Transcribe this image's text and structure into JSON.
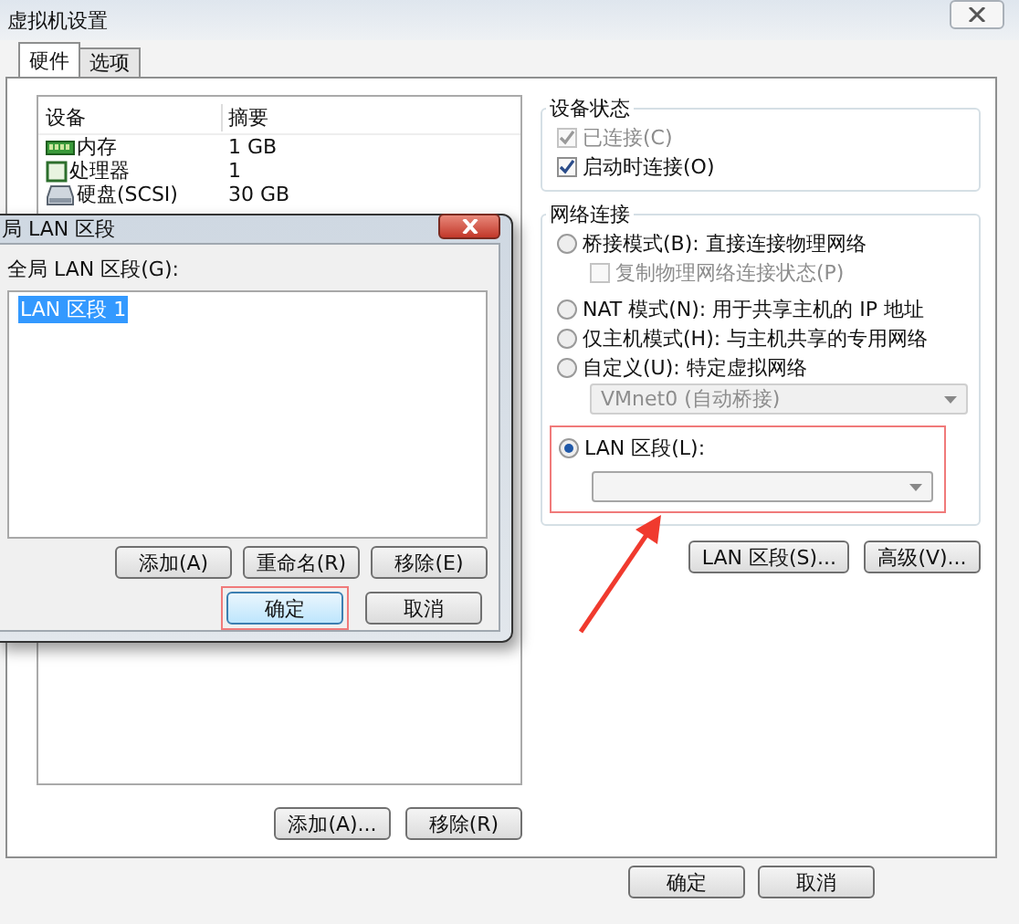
{
  "window": {
    "title": "虚拟机设置"
  },
  "tabs": [
    {
      "label": "硬件",
      "selected": true
    },
    {
      "label": "选项",
      "selected": false
    }
  ],
  "device_table": {
    "columns": [
      "设备",
      "摘要"
    ],
    "rows": [
      {
        "kind": "memory",
        "device": "内存",
        "summary": "1 GB"
      },
      {
        "kind": "cpu",
        "device": "处理器",
        "summary": "1"
      },
      {
        "kind": "disk",
        "device": "硬盘(SCSI)",
        "summary": "30 GB"
      }
    ]
  },
  "device_buttons": [
    "添加(A)...",
    "移除(R)"
  ],
  "device_status": {
    "title": "设备状态",
    "options": [
      {
        "label": "已连接(C)",
        "checked": true,
        "disabled": true
      },
      {
        "label": "启动时连接(O)",
        "checked": true,
        "disabled": false
      }
    ]
  },
  "network": {
    "title": "网络连接",
    "options": [
      {
        "kind": "radio",
        "label": "桥接模式(B): 直接连接物理网络",
        "selected": false
      },
      {
        "kind": "checkbox",
        "label": "复制物理网络连接状态(P)",
        "checked": false,
        "disabled": true
      },
      {
        "kind": "radio",
        "label": "NAT 模式(N): 用于共享主机的 IP 地址",
        "selected": false
      },
      {
        "kind": "radio",
        "label": "仅主机模式(H): 与主机共享的专用网络",
        "selected": false
      },
      {
        "kind": "radio",
        "label": "自定义(U): 特定虚拟网络",
        "selected": false
      },
      {
        "kind": "dropdown",
        "value": "VMnet0 (自动桥接)",
        "disabled": true
      }
    ],
    "lan_segment": {
      "label": "LAN 区段(L):",
      "selected": true,
      "highlighted": true,
      "dropdown_disabled": false
    }
  },
  "network_buttons": [
    "LAN 区段(S)...",
    "高级(V)..."
  ],
  "footer_buttons": [
    "确定",
    "取消"
  ],
  "dialog": {
    "title": "局 LAN 区段",
    "list_label": "全局 LAN 区段(G):",
    "items": [
      {
        "label": "LAN 区段 1",
        "selected": true
      }
    ],
    "list_buttons": [
      "添加(A)",
      "重命名(R)",
      "移除(E)"
    ],
    "buttons": [
      {
        "label": "确定",
        "highlighted": true
      },
      {
        "label": "取消",
        "highlighted": false
      }
    ]
  },
  "annotation_arrow": true
}
